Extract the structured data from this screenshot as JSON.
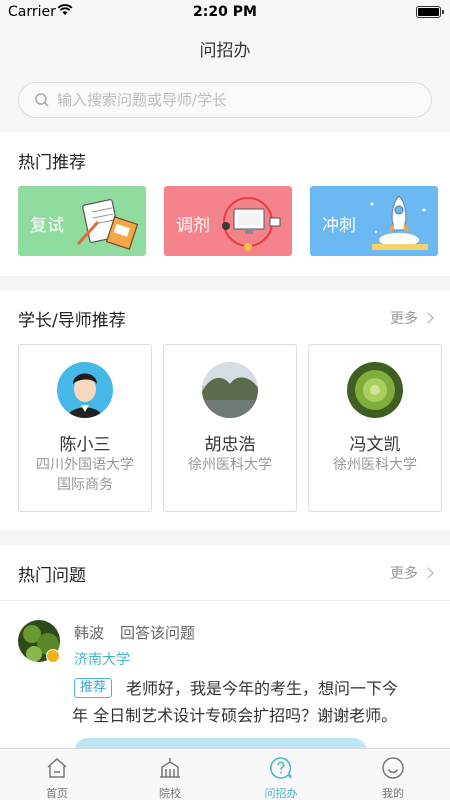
{
  "status_bar": {
    "carrier": "Carrier",
    "time": "2:20 PM"
  },
  "nav": {
    "title": "问招办"
  },
  "search": {
    "placeholder": "输入搜索问题或导师/学长"
  },
  "hot": {
    "title": "热门推荐",
    "cards": [
      {
        "label": "复试",
        "color": "#8fdc9e"
      },
      {
        "label": "调剂",
        "color": "#f4838c"
      },
      {
        "label": "冲刺",
        "color": "#6cb8f2"
      }
    ]
  },
  "mentors": {
    "title": "学长/导师推荐",
    "more": "更多",
    "items": [
      {
        "name": "陈小三",
        "school_line1": "四川外国语大学",
        "school_line2": "国际商务"
      },
      {
        "name": "胡忠浩",
        "school_line1": "徐州医科大学",
        "school_line2": ""
      },
      {
        "name": "冯文凯",
        "school_line1": "徐州医科大学",
        "school_line2": ""
      }
    ]
  },
  "questions": {
    "title": "热门问题",
    "more": "更多",
    "first": {
      "user": "韩波",
      "action": "回答该问题",
      "school": "济南大学",
      "tag": "推荐",
      "text_line1": "老师好，我是今年的考生，想问一下今",
      "text_line2": "年 全日制艺术设计专硕会扩招吗？谢谢老师。"
    }
  },
  "tabs": [
    {
      "label": "首页",
      "icon": "home-icon",
      "active": false
    },
    {
      "label": "院校",
      "icon": "school-icon",
      "active": false
    },
    {
      "label": "问招办",
      "icon": "question-bubble-icon",
      "active": true
    },
    {
      "label": "我的",
      "icon": "profile-icon",
      "active": false
    }
  ],
  "colors": {
    "accent": "#4ab5c5",
    "tag": "#3aa3cc"
  }
}
